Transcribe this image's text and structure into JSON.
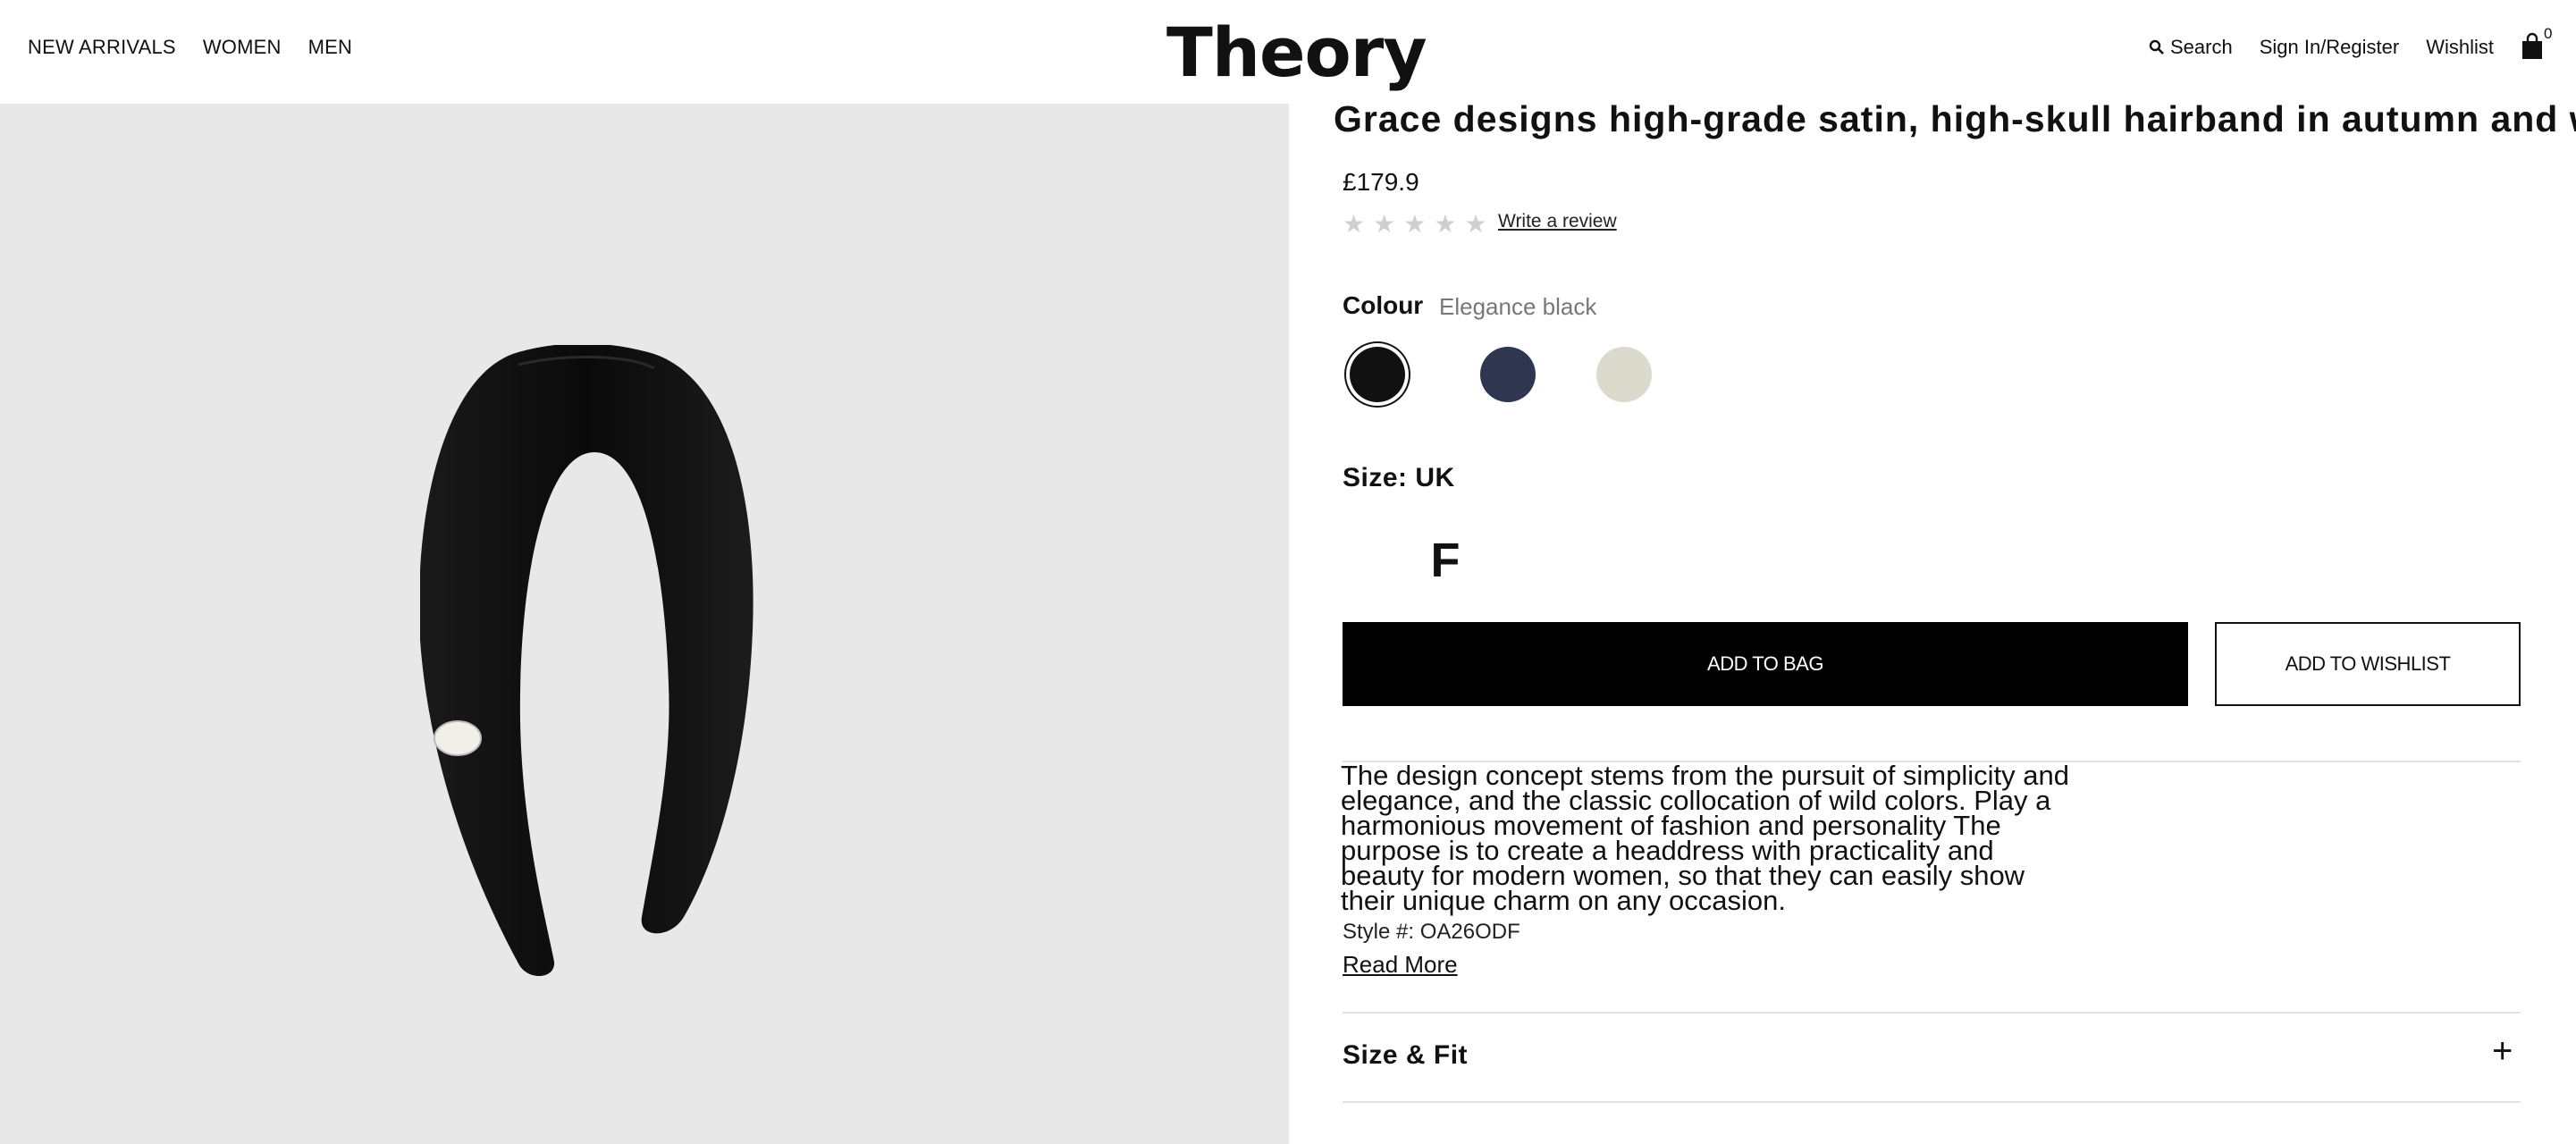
{
  "header": {
    "nav_left": [
      "NEW ARRIVALS",
      "WOMEN",
      "MEN"
    ],
    "logo": "Theory",
    "search_label": "Search",
    "sign_in_label": "Sign In/Register",
    "wishlist_label": "Wishlist",
    "bag_count": "0"
  },
  "product": {
    "title": "Grace designs high-grade satin, high-skull hairband in autumn and winter",
    "price": "£179.9",
    "rating": 0,
    "write_review": "Write a review",
    "colour_label": "Colour",
    "colour_value": "Elegance black",
    "colours": [
      "#111111",
      "#2f3650",
      "#dcd9cd"
    ],
    "size_label": "Size: UK",
    "size_value": "F",
    "add_to_bag": "ADD TO BAG",
    "add_to_wishlist": "ADD TO WISHLIST",
    "description": "The design concept stems from the pursuit of simplicity and elegance, and the classic collocation of wild colors. Play a harmonious movement of fashion and personality The purpose is to create a headdress with practicality and beauty for modern women, so that they can easily show their unique charm on any occasion.",
    "style_number": "Style #: OA26ODF",
    "read_more": "Read More",
    "accordion_size_fit": "Size & Fit"
  }
}
